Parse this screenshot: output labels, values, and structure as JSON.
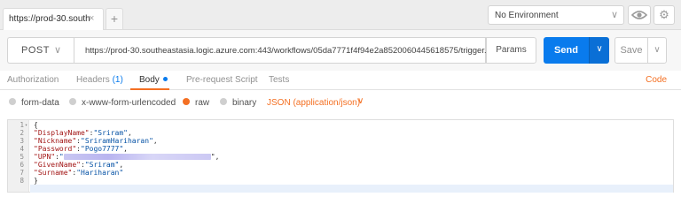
{
  "tab_strip": {
    "request_tab_label": "https://prod-30.south",
    "close_symbol": "×",
    "new_tab_symbol": "+",
    "environment": "No Environment",
    "chevron_symbol": "∨",
    "settings_symbol": "⚙"
  },
  "request": {
    "method": "POST",
    "url": "https://prod-30.southeastasia.logic.azure.com:443/workflows/05da7771f4f94e2a8520060445618575/trigger...",
    "params_label": "Params",
    "send_label": "Send",
    "save_label": "Save"
  },
  "section_tabs": {
    "authorization": "Authorization",
    "headers": "Headers",
    "headers_count": "(1)",
    "body": "Body",
    "pre_request": "Pre-request Script",
    "tests": "Tests",
    "code": "Code"
  },
  "body_types": {
    "form_data": "form-data",
    "urlencoded": "x-www-form-urlencoded",
    "raw": "raw",
    "binary": "binary",
    "content_type": "JSON (application/json)",
    "selected": "raw"
  },
  "editor": {
    "line_numbers": [
      "1",
      "2",
      "3",
      "4",
      "5",
      "6",
      "7",
      "8"
    ],
    "fold_marker": "▾",
    "open_brace": "{",
    "close_brace": "}",
    "lines": [
      {
        "key": "\"DisplayName\"",
        "sep": ":",
        "value": "\"Sriram\"",
        "tail": ","
      },
      {
        "key": "\"Nickname\"",
        "sep": ":",
        "value": "\"SriramHariharan\"",
        "tail": ","
      },
      {
        "key": "\"Password\"",
        "sep": ":",
        "value": "\"Pogo7777\"",
        "tail": ","
      },
      {
        "key": "\"UPN\"",
        "sep": ":",
        "value": "\"",
        "tail": "\","
      },
      {
        "key": "\"GivenName\"",
        "sep": ":",
        "value": "\"Sriram\"",
        "tail": ","
      },
      {
        "key": "\"Surname\"",
        "sep": ":",
        "value": "\"Hariharan\"",
        "tail": ""
      }
    ]
  },
  "colors": {
    "accent_orange": "#f47023",
    "send_blue": "#097bed"
  }
}
